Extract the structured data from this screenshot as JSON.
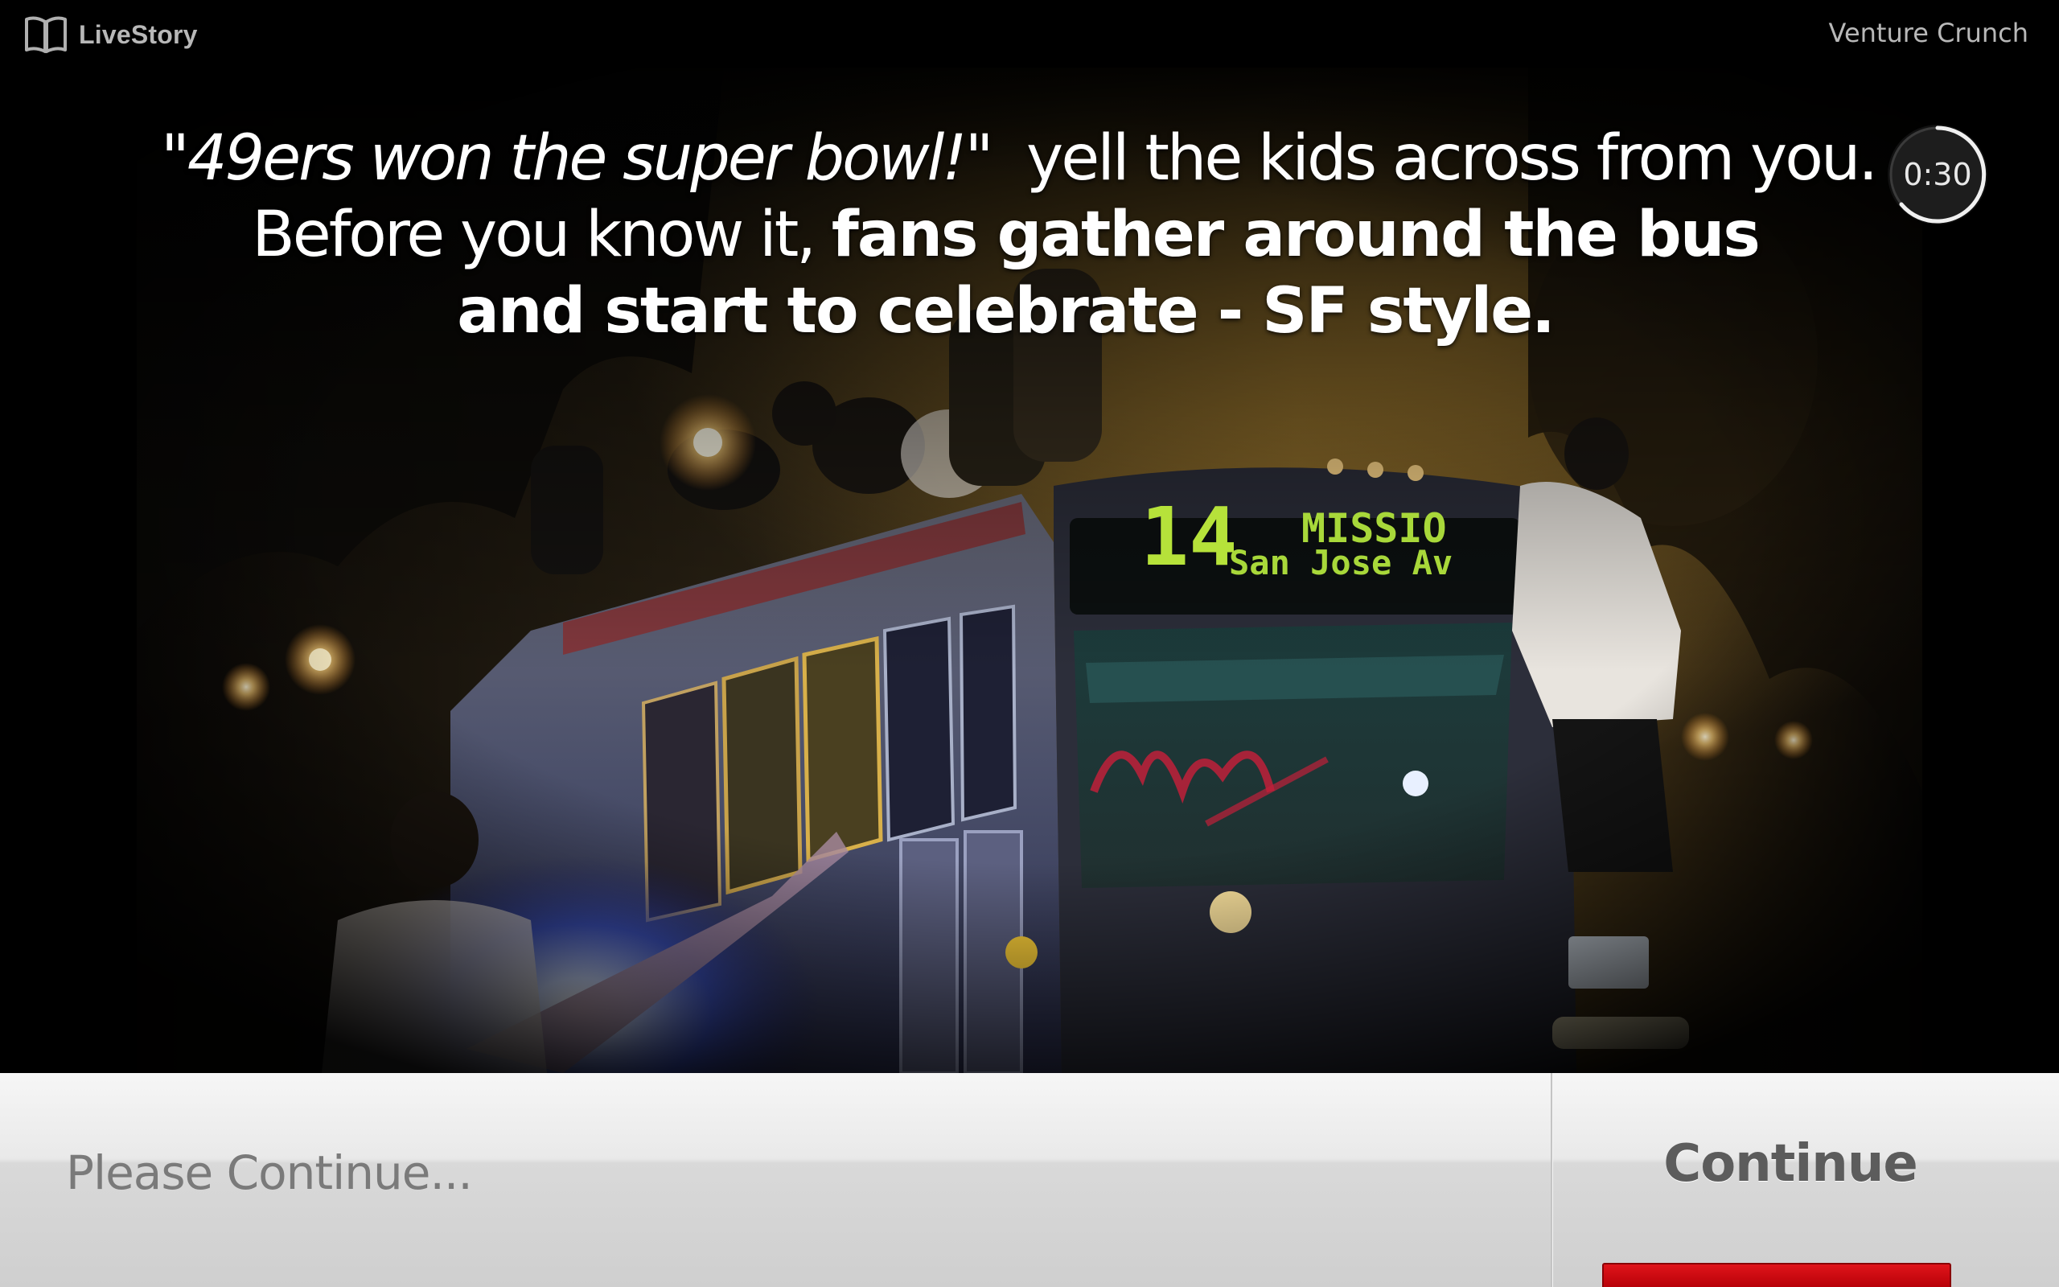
{
  "app": {
    "brand_name": "LiveStory",
    "brand_icon": "open-book-icon",
    "publisher": "Venture Crunch"
  },
  "story": {
    "caption": {
      "quote": "\"49ers won the super bowl!\"",
      "line1_rest": "yell the kids across from you.",
      "line2_plain": "Before you know it,",
      "line2_bold": "fans gather around the bus",
      "line3_bold": "and start to celebrate -  SF style."
    },
    "timer": "0:30",
    "bus_sign": {
      "route_number": "14",
      "destination_top": "MISSIO",
      "destination_bottom": "San Jose Av"
    }
  },
  "footer": {
    "status_text": "Please Continue...",
    "continue_label": "Continue",
    "accent_color": "#d4000b"
  }
}
